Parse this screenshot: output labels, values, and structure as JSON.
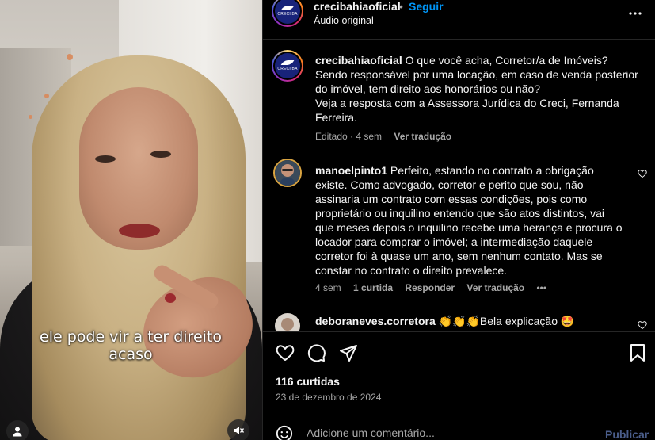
{
  "video": {
    "caption_line1": "ele pode vir a ter direito",
    "caption_line2": "acaso"
  },
  "header": {
    "username": "crecibahiaoficial",
    "separator": "•",
    "follow_label": "Seguir",
    "audio_label": "Áudio original",
    "more_icon": "more-horizontal-icon",
    "logo_text": "CRECI BA"
  },
  "caption_post": {
    "username": "crecibahiaoficial",
    "text": " O que você acha, Corretor/a de Imóveis? Sendo responsável por uma locação, em caso de venda posterior do imóvel, tem direito aos honorários ou não?",
    "text2": "Veja a resposta com a Assessora Jurídica do Creci, Fernanda Ferreira.",
    "edited": "Editado · 4 sem",
    "translate": "Ver tradução"
  },
  "comments": [
    {
      "username": "manoelpinto1",
      "text": " Perfeito, estando no contrato a obrigação existe. Como advogado, corretor e perito que sou, não assinaria um contrato com essas condições, pois como proprietário ou inquilino entendo que são atos distintos, vai que meses depois o inquilino recebe uma herança e procura o locador para comprar o imóvel; a intermediação daquele corretor foi à quase um ano, sem nenhum contato. Mas se constar no contrato o direito prevalece.",
      "time": "4 sem",
      "likes": "1 curtida",
      "reply": "Responder",
      "translate": "Ver tradução",
      "more": "•••"
    },
    {
      "username": "deboraneves.corretora",
      "text": " 👏👏👏Bela explicação 🤩"
    }
  ],
  "actions": {
    "likes": "116 curtidas",
    "date": "23 de dezembro de 2024"
  },
  "composer": {
    "placeholder": "Adicione um comentário...",
    "publish": "Publicar"
  },
  "colors": {
    "background": "#000000",
    "text": "#f5f5f5",
    "muted": "#a8a8a8",
    "link": "#0095f6",
    "publish_disabled": "#4a5d8a"
  }
}
